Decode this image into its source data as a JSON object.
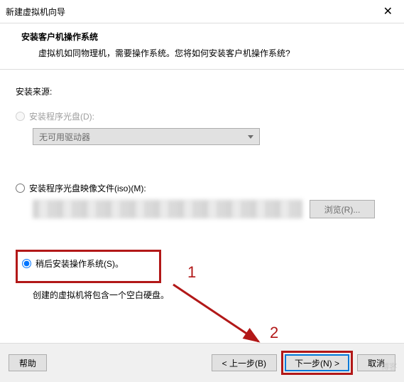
{
  "titlebar": {
    "title": "新建虚拟机向导"
  },
  "header": {
    "title": "安装客户机操作系统",
    "subtitle": "虚拟机如同物理机，需要操作系统。您将如何安装客户机操作系统?"
  },
  "content": {
    "source_label": "安装来源:",
    "opt_disc": {
      "label": "安装程序光盘(D):",
      "dropdown": "无可用驱动器"
    },
    "opt_iso": {
      "label": "安装程序光盘映像文件(iso)(M):",
      "browse": "浏览(R)..."
    },
    "opt_later": {
      "label": "稍后安装操作系统(S)。",
      "hint": "创建的虚拟机将包含一个空白硬盘。"
    }
  },
  "footer": {
    "help": "帮助",
    "back": "< 上一步(B)",
    "next": "下一步(N) >",
    "cancel": "取消"
  },
  "annotations": {
    "n1": "1",
    "n2": "2"
  },
  "watermark": "博客"
}
